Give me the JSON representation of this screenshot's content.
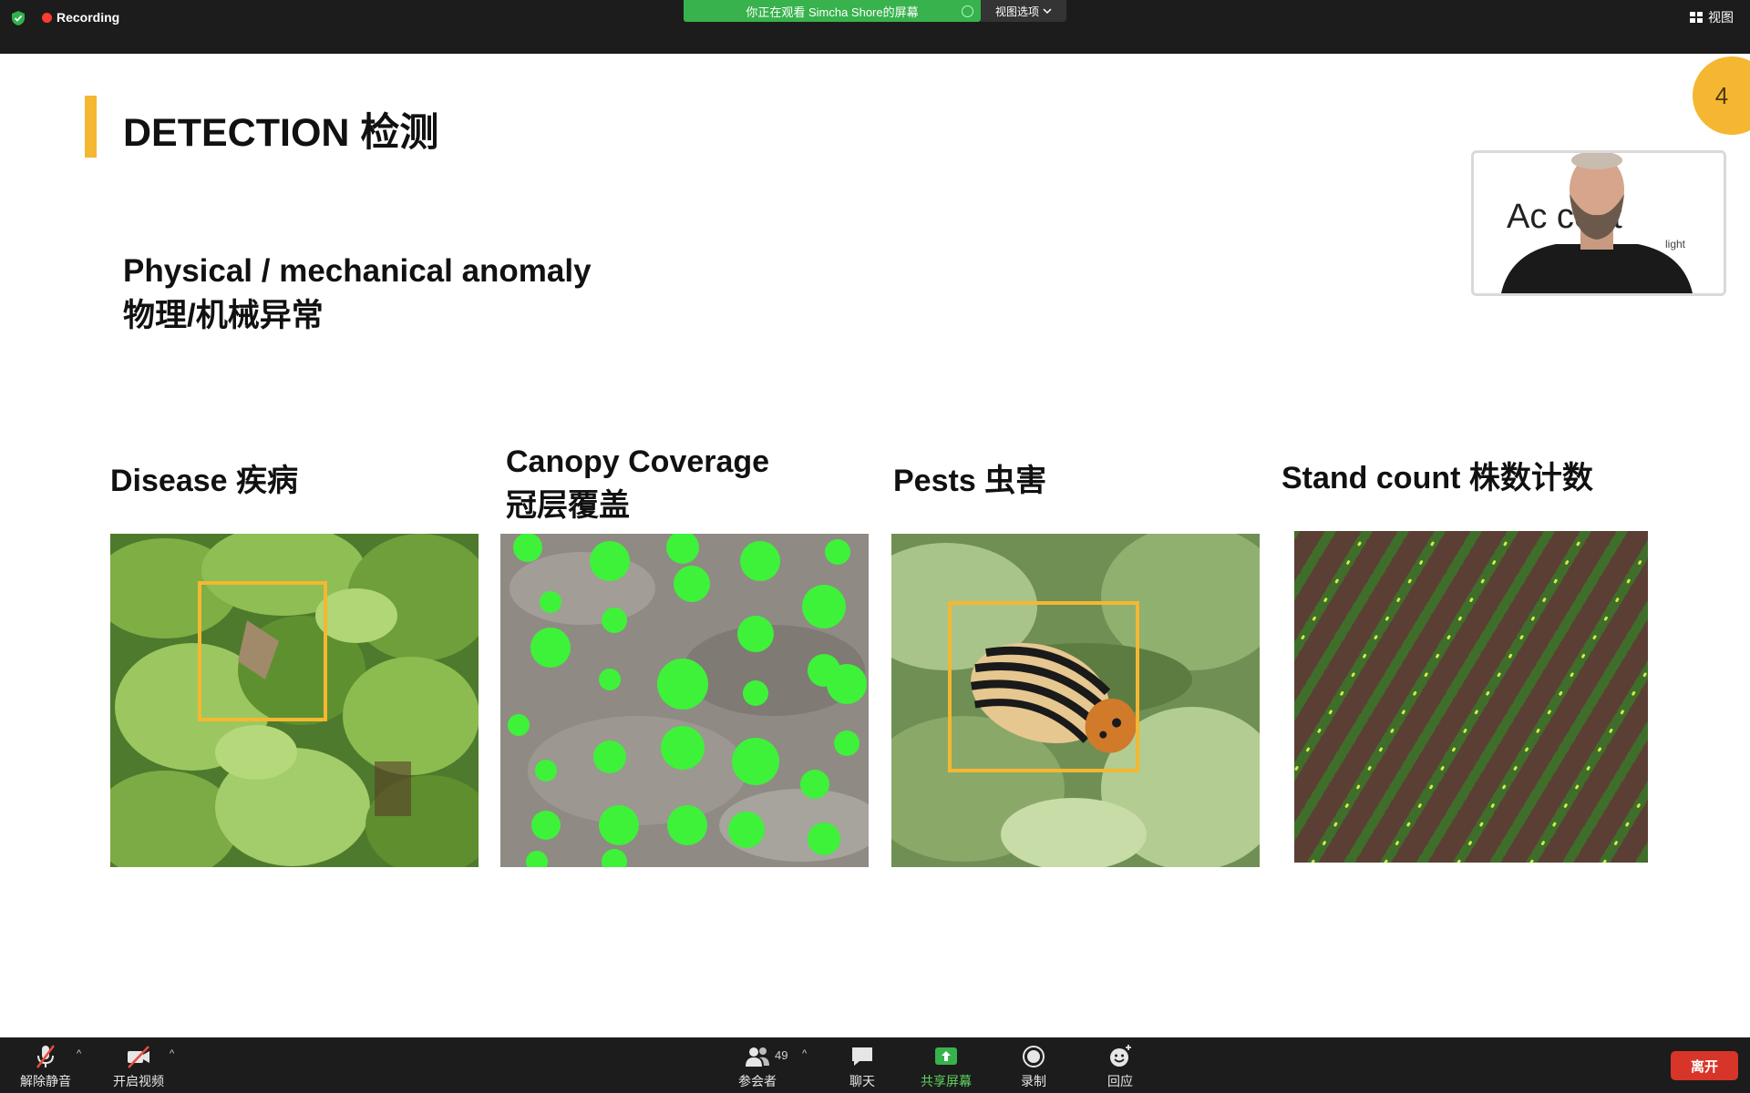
{
  "topbar": {
    "recording_label": "Recording",
    "viewing_banner": "你正在观看 Simcha Shore的屏幕",
    "view_options_label": "视图选项",
    "view_label": "视图"
  },
  "slide": {
    "title": "DETECTION 检测",
    "subtitle_en": "Physical / mechanical anomaly",
    "subtitle_zh": "物理/机械异常",
    "page_number": "4",
    "categories": [
      {
        "line1": "Disease 疾病",
        "line2": ""
      },
      {
        "line1": "Canopy Coverage",
        "line2": "冠层覆盖"
      },
      {
        "line1": "Pests 虫害",
        "line2": ""
      },
      {
        "line1": "Stand count 株数计数",
        "line2": ""
      }
    ],
    "accent_color": "#f5b731"
  },
  "video": {
    "logo_text": "Ac        cout",
    "logo_sub": "light"
  },
  "toolbar": {
    "unmute_label": "解除静音",
    "start_video_label": "开启视频",
    "participants_label": "参会者",
    "participant_count": "49",
    "chat_label": "聊天",
    "share_label": "共享屏幕",
    "record_label": "录制",
    "reactions_label": "回应",
    "leave_label": "离开"
  }
}
